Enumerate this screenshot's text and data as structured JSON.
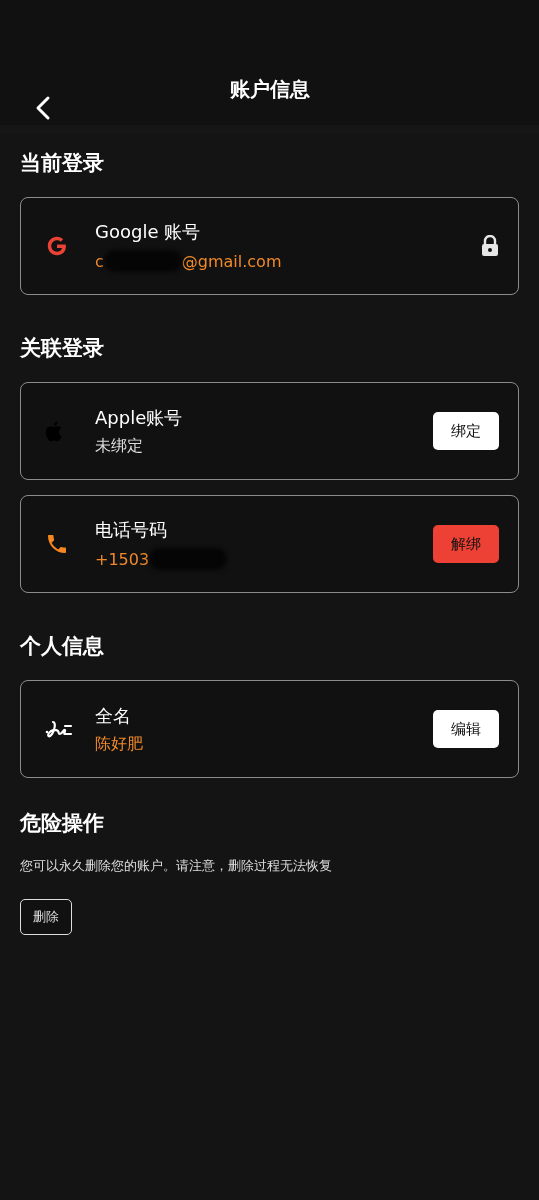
{
  "header": {
    "title": "账户信息"
  },
  "sections": [
    {
      "title": "当前登录",
      "cards": [
        {
          "kind": "google",
          "title": "Google 账号",
          "value_start": "c",
          "value_end": "@gmail.com",
          "redacted": true,
          "action": {
            "kind": "lock"
          }
        }
      ]
    },
    {
      "title": "关联登录",
      "cards": [
        {
          "kind": "apple",
          "title": "Apple账号",
          "value_start": "未绑定",
          "redacted": false,
          "action": {
            "kind": "light",
            "label": "绑定"
          }
        },
        {
          "kind": "phone",
          "title": "电话号码",
          "value_start": "+1503",
          "redacted": true,
          "action": {
            "kind": "danger",
            "label": "解绑"
          }
        }
      ]
    },
    {
      "title": "个人信息",
      "cards": [
        {
          "kind": "name",
          "title": "全名",
          "value_start": "陈好肥",
          "redacted": false,
          "action": {
            "kind": "light",
            "label": "编辑"
          }
        }
      ]
    }
  ],
  "danger": {
    "title": "危险操作",
    "text": "您可以永久删除您的账户。请注意，删除过程无法恢复",
    "button": "删除"
  }
}
